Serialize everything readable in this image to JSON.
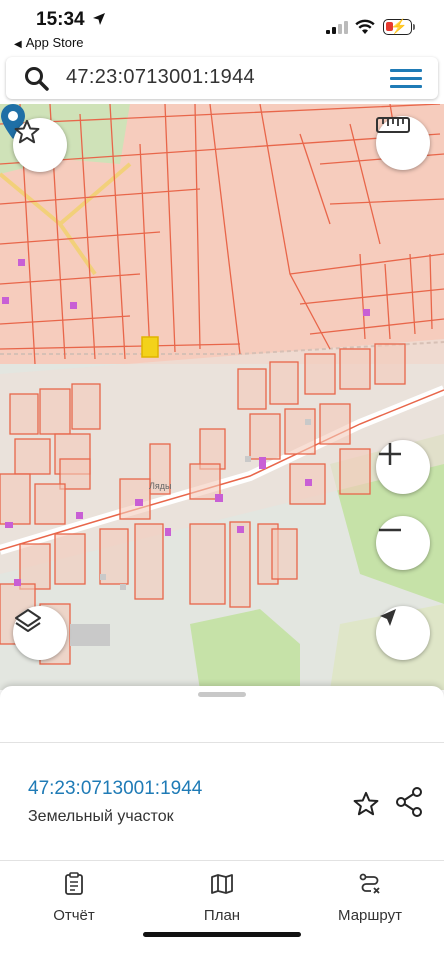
{
  "status_bar": {
    "time": "15:34",
    "back_label": "App Store"
  },
  "search": {
    "query": "47:23:0713001:1944"
  },
  "map": {
    "place_label": "Ляды"
  },
  "sheet": {
    "parcel_id": "47:23:0713001:1944",
    "parcel_type": "Земельный участок"
  },
  "tabs": [
    {
      "label": "Отчёт",
      "icon": "report-icon"
    },
    {
      "label": "План",
      "icon": "map-plan-icon"
    },
    {
      "label": "Маршрут",
      "icon": "route-icon"
    }
  ],
  "colors": {
    "accent": "#1f7bb6",
    "parcel_line": "#e8664a",
    "parcel_fill": "#f7d7cb"
  }
}
